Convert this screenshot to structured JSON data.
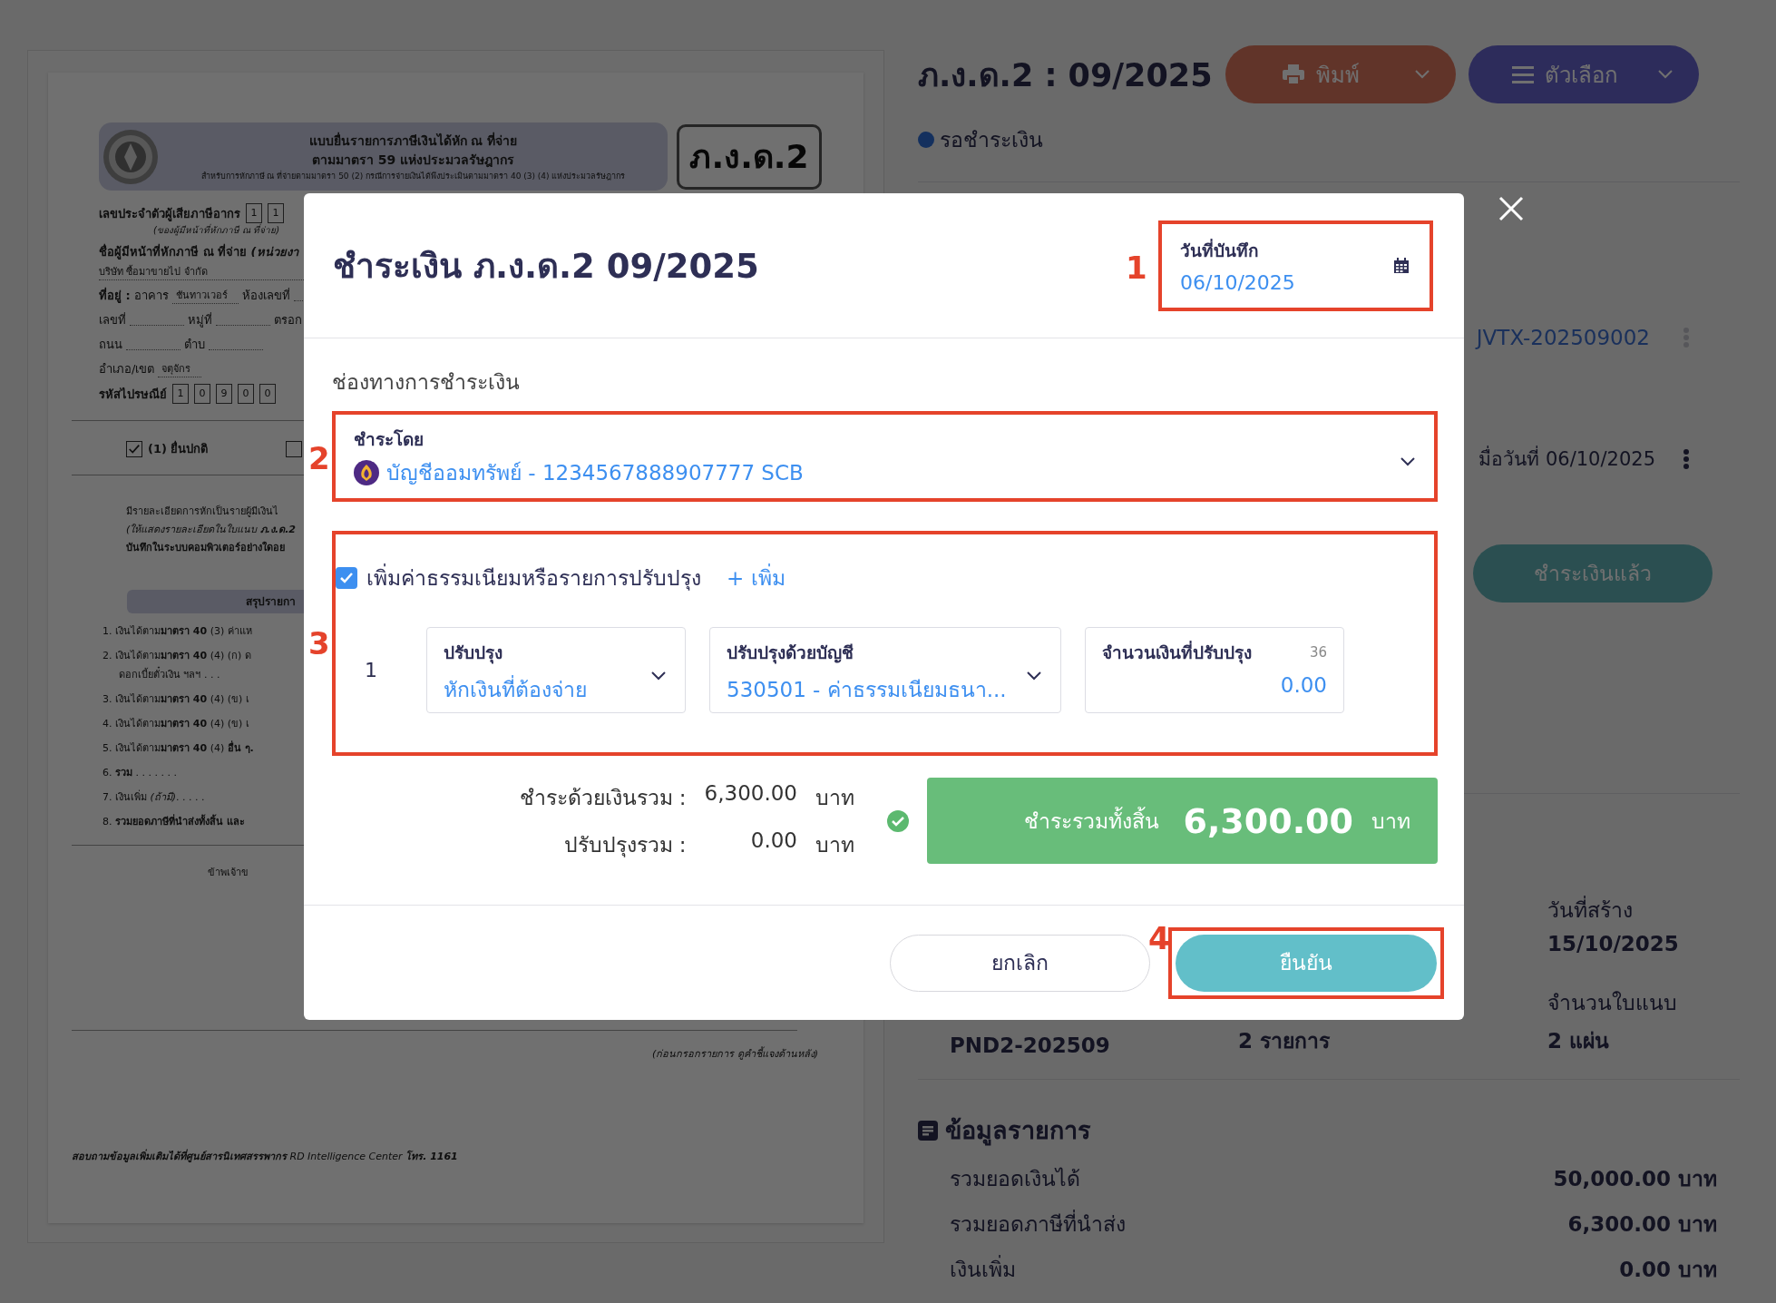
{
  "document": {
    "header_lines": [
      "แบบยื่นรายการภาษีเงินได้หัก ณ ที่จ่าย",
      "ตามมาตรา 59 แห่งประมวลรัษฎากร",
      "สำหรับการหักภาษี ณ ที่จ่ายตามมาตรา 50 (2) กรณีการจ่ายเงินได้พึงประเมินตามมาตรา 40 (3) (4) แห่งประมวลรัษฎากร"
    ],
    "form_code": "ภ.ง.ด.2",
    "tax_id_label": "เลขประจำตัวผู้เสียภาษีอากร",
    "tax_id_digits": [
      "1",
      "1"
    ],
    "tax_id_note": "(ของผู้มีหน้าที่หักภาษี ณ ที่จ่าย)",
    "payer_label": "ชื่อผู้มีหน้าที่หักภาษี ณ ที่จ่าย *(หน่วยงา*",
    "payer_name": "บริษัท ซื้อมาขายไป จำกัด",
    "address_rows": [
      [
        {
          "label": "**ที่อยู่ :** อาคาร",
          "value": "ชันทาวเวอร์"
        },
        {
          "label": "ห้องเลขที่"
        }
      ],
      [
        {
          "label": "เลขที่"
        },
        {
          "label": "หมู่ที่"
        },
        {
          "label": "ตรอก"
        }
      ],
      [
        {
          "label": "ถนน"
        },
        {
          "label": "ตำบ"
        }
      ],
      [
        {
          "label": "อำเภอ/เขต",
          "value": "จตุจักร"
        }
      ]
    ],
    "postal_label": "รหัสไปรษณีย์",
    "postal_digits": [
      "1",
      "0",
      "9",
      "0",
      "0"
    ],
    "filing_options": [
      {
        "label": "(1) ยื่นปกติ",
        "checked": true
      },
      {
        "checked": false
      }
    ],
    "detail_lines": [
      "มีรายละเอียดการหักเป็นรายผู้มีเงินไ",
      "*(ให้แสดงรายละเอียดในใบแนบ* **ภ.ง.ด.2**",
      "**บันทึกในระบบคอมพิวเตอร์อย่างใดอย**"
    ],
    "summary_title": "สรุปรายกา",
    "summary_items": [
      "1. เงินได้ตาม**มาตรา 40** (3) ค่าแห",
      "2. เงินได้ตาม**มาตรา 40** (4) (ก) ด",
      "ดอกเบี้ยตั๋วเงิน ฯลฯ  .  .  .",
      "3. เงินได้ตาม**มาตรา 40** (4) (ข) เ",
      "4. เงินได้ตาม**มาตรา 40** (4) (ข) เ",
      "5. เงินได้ตาม**มาตรา 40** (4) **อื่น ๆ.**",
      "6. **รวม**  .  .  .  .  .  .  .",
      "7. เงินเพิ่ม *(ถ้ามี)*.  .  .  .  .",
      "8. **รวมยอดภาษีที่นำส่งทั้งสิ้น และ**"
    ],
    "declaration": "ข้าพเจ้าข",
    "instruction_note": "(ก่อนกรอกรายการ ดูคำชี้แจงด้านหลัง)",
    "footer": "**สอบถามข้อมูลเพิ่มเติมได้ที่ศูนย์สารนิเทศสรรพากร** RD Intelligence Center **โทร. 1161**"
  },
  "record": {
    "title": "ภ.ง.ด.2 : 09/2025",
    "print_button": "พิมพ์",
    "options_button": "ตัวเลือก",
    "status": "รอชำระเงิน",
    "journal_ref": "JVTX-202509002",
    "paid_note": "มื่อวันที่ 06/10/2025",
    "paid_button": "ชำระเงินแล้ว",
    "created": {
      "label": "วันที่สร้าง",
      "value": "15/10/2025"
    },
    "details": [
      {
        "value": "PND2-202509"
      },
      {
        "value": "2 รายการ"
      },
      {
        "label": "จำนวนใบแนบ",
        "value": "2 แผ่น"
      }
    ],
    "summary": {
      "title": "ข้อมูลรายการ",
      "rows": [
        {
          "label": "รวมยอดเงินได้",
          "value": "50,000.00 บาท"
        },
        {
          "label": "รวมยอดภาษีที่นำส่ง",
          "value": "6,300.00 บาท"
        },
        {
          "label": "เงินเพิ่ม",
          "value": "0.00 บาท"
        }
      ]
    }
  },
  "payment_dialog": {
    "title": "ชำระเงิน ภ.ง.ด.2 09/2025",
    "date_field": {
      "label": "วันที่บันทึก",
      "value": "06/10/2025"
    },
    "channel_heading": "ช่องทางการชำระเงิน",
    "pay_by": {
      "label": "ชำระโดย",
      "value": "บัญชีออมทรัพย์ - 1234567888907777 SCB"
    },
    "adjust": {
      "checked": true,
      "label": "เพิ่มค่าธรรมเนียมหรือรายการปรับปรุง",
      "add_link": "+ เพิ่ม",
      "rows": [
        {
          "index": "1",
          "type": {
            "label": "ปรับปรุง",
            "value": "หักเงินที่ต้องจ่าย"
          },
          "account": {
            "label": "ปรับปรุงด้วยบัญชี",
            "value": "530501 - ค่าธรรมเนียมธนา..."
          },
          "amount": {
            "label": "จำนวนเงินที่ปรับปรุง",
            "counter": "36",
            "value": "0.00"
          }
        }
      ]
    },
    "totals": [
      {
        "label": "ชำระด้วยเงินรวม :",
        "value": "6,300.00",
        "unit": "บาท"
      },
      {
        "label": "ปรับปรุงรวม :",
        "value": "0.00",
        "unit": "บาท"
      }
    ],
    "grand_total": {
      "label": "ชำระรวมทั้งสิ้น",
      "value": "6,300.00",
      "unit": "บาท"
    },
    "cancel_button": "ยกเลิก",
    "confirm_button": "ยืนยัน"
  },
  "annotations": [
    "1",
    "2",
    "3",
    "4"
  ]
}
